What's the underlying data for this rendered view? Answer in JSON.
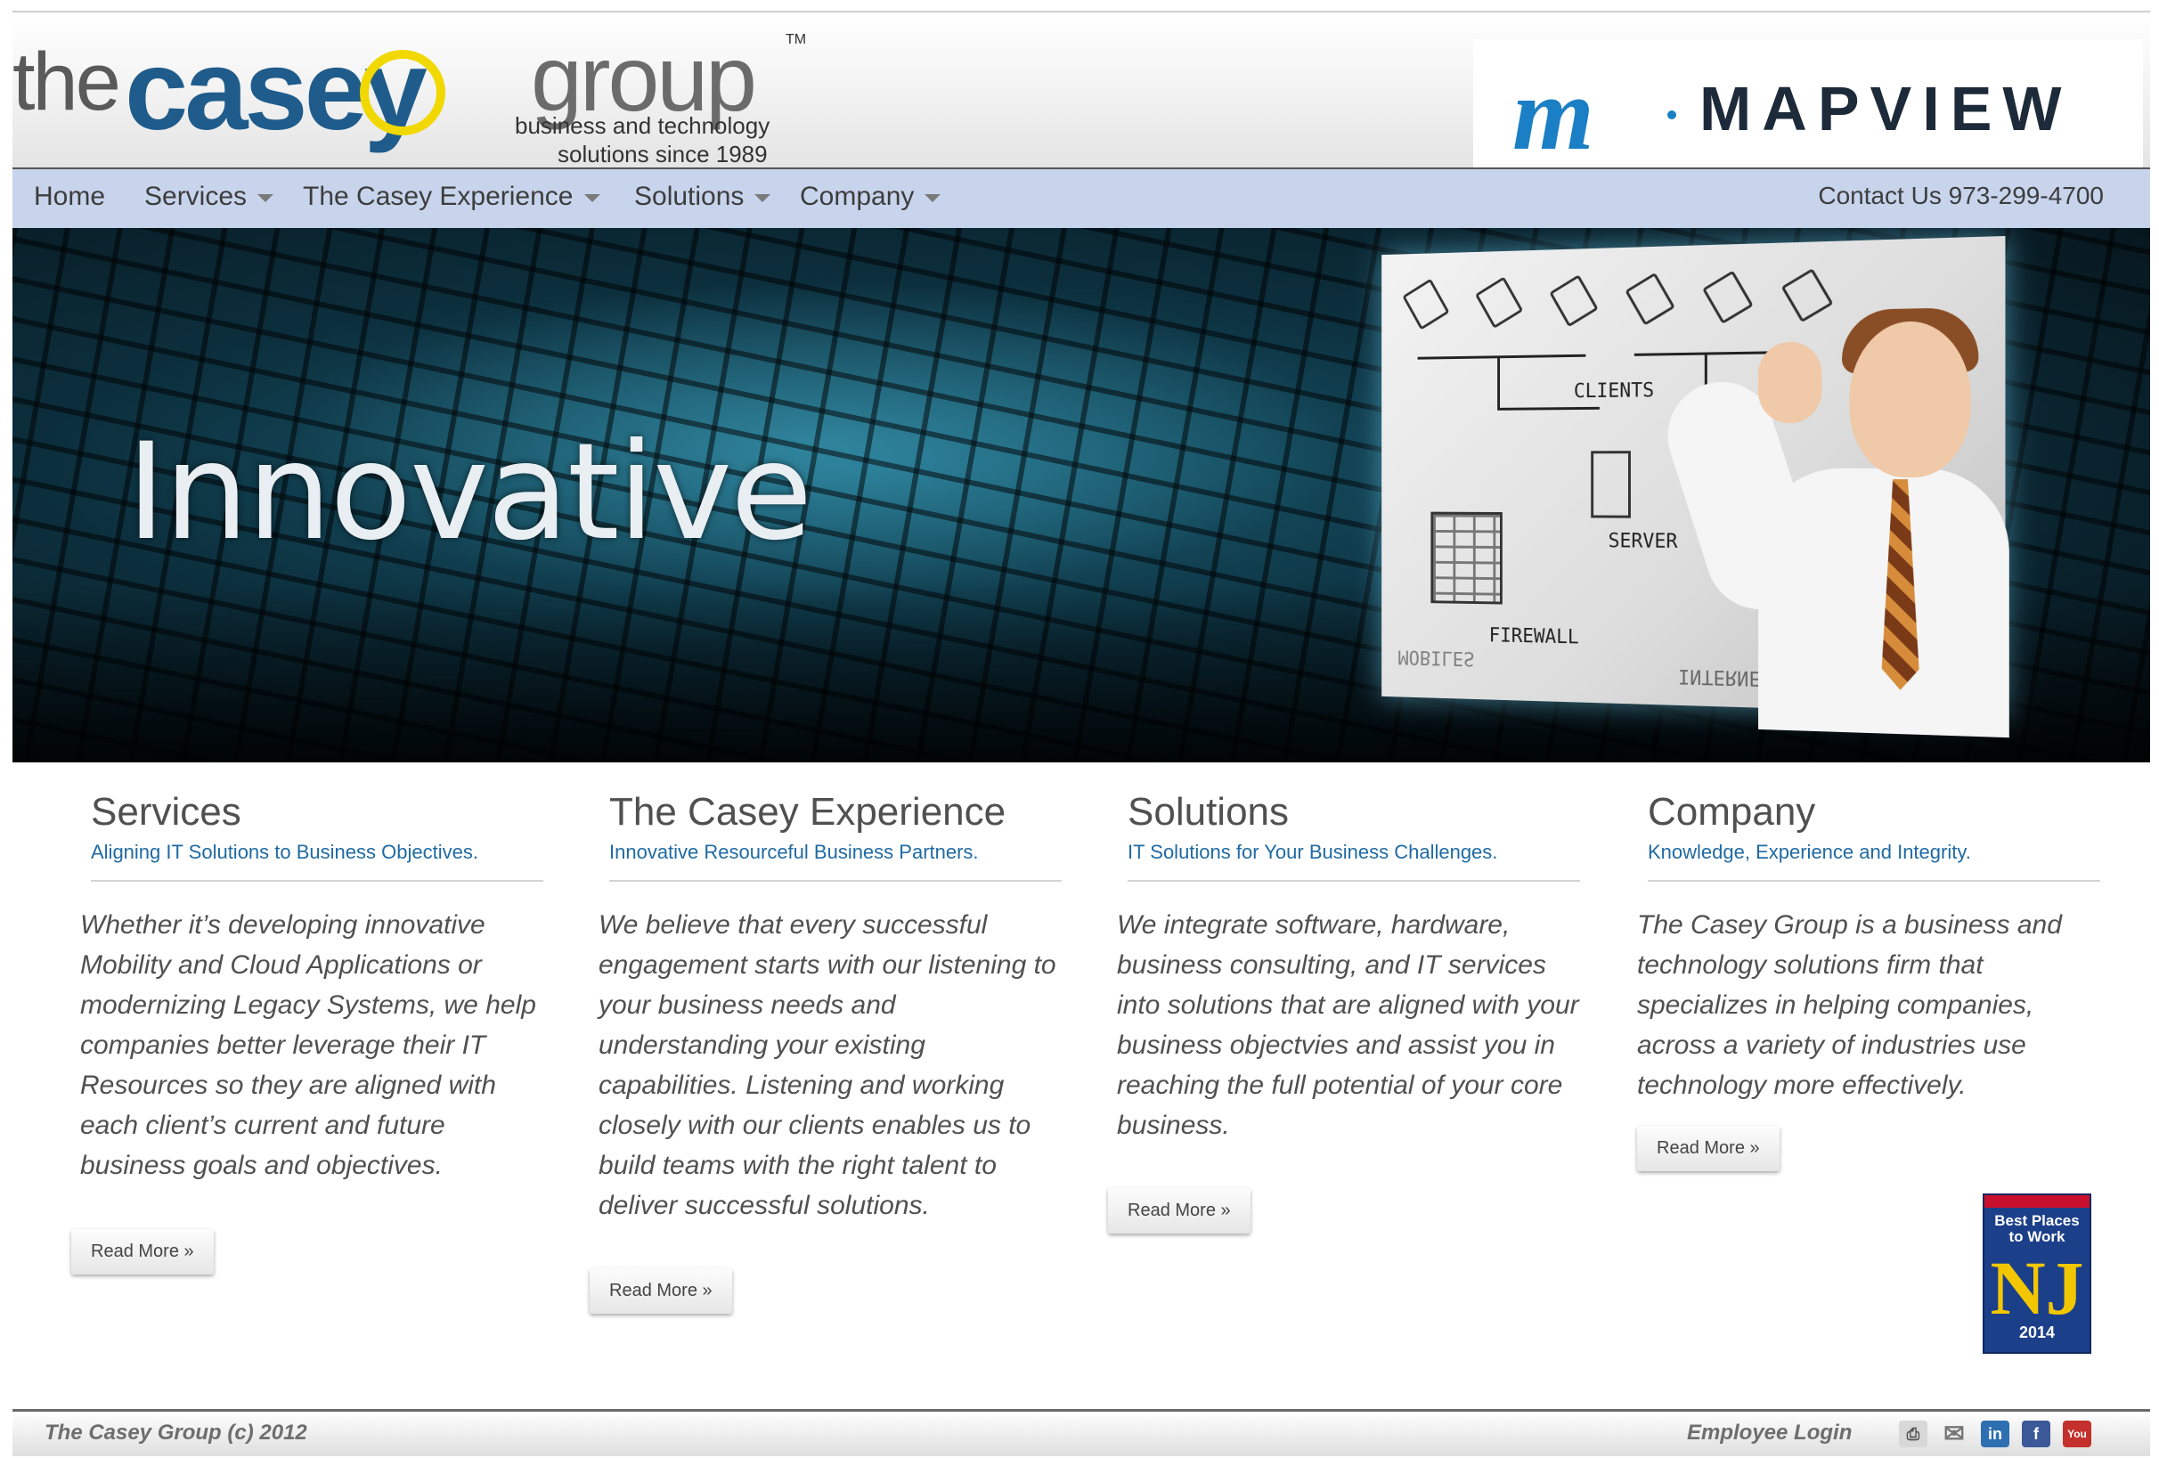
{
  "header": {
    "logo_the": "the",
    "logo_casey": "casey",
    "logo_group": "group",
    "logo_tm": "TM",
    "tagline_1": "business and technology",
    "tagline_2": "solutions since 1989",
    "partner_logo_text": "MAPVIEW",
    "partner_logo_mark": "m"
  },
  "nav": {
    "items": [
      {
        "label": "Home",
        "dropdown": false
      },
      {
        "label": "Services",
        "dropdown": true
      },
      {
        "label": "The Casey Experience",
        "dropdown": true
      },
      {
        "label": "Solutions",
        "dropdown": true
      },
      {
        "label": "Company",
        "dropdown": true
      }
    ],
    "contact": "Contact Us 973-299-4700"
  },
  "hero": {
    "headline": "Innovative",
    "whiteboard_labels": [
      "CLIENTS",
      "SERVER",
      "FIREWALL",
      "INTERNET",
      "MOBILES"
    ]
  },
  "columns": [
    {
      "title": "Services",
      "subtitle": "Aligning IT Solutions to Business Objectives.",
      "body": "Whether it’s developing innovative Mobility and Cloud Applications or modernizing Legacy Systems, we help companies better leverage their IT Resources so they are aligned with each client’s current and future business goals and objectives.",
      "button": "Read More »"
    },
    {
      "title": "The Casey Experience",
      "subtitle": "Innovative Resourceful Business Partners.",
      "body": "We believe that every successful engagement starts with our listening to your business needs and understanding your existing capabilities. Listening and working closely with our clients enables us to build teams with the right talent to deliver successful solutions.",
      "button": "Read More »"
    },
    {
      "title": "Solutions",
      "subtitle": "IT Solutions for Your Business Challenges.",
      "body": "We integrate software, hardware, business consulting, and IT services into solutions that are aligned with your business objectvies and assist you in reaching the full potential of your core business.",
      "button": "Read More »"
    },
    {
      "title": "Company",
      "subtitle": "Knowledge, Experience and Integrity.",
      "body": "The Casey Group is a business and technology solutions firm that specializes in helping companies, across a variety of industries use technology more effectively.",
      "button": "Read More »"
    }
  ],
  "badge": {
    "line1": "Best Places",
    "line2": "to Work",
    "state": "NJ",
    "year": "2014"
  },
  "footer": {
    "copyright": "The Casey Group (c) 2012",
    "login": "Employee Login",
    "icons": [
      "print-icon",
      "email-icon",
      "linkedin-icon",
      "facebook-icon",
      "youtube-icon"
    ],
    "icon_labels": {
      "linkedin": "in",
      "facebook": "f",
      "youtube": "You"
    }
  },
  "colors": {
    "brand_blue": "#1f5c8c",
    "nav_bg": "#c7d4ec",
    "link_blue": "#1f6aa3",
    "accent_yellow": "#f0d800"
  }
}
